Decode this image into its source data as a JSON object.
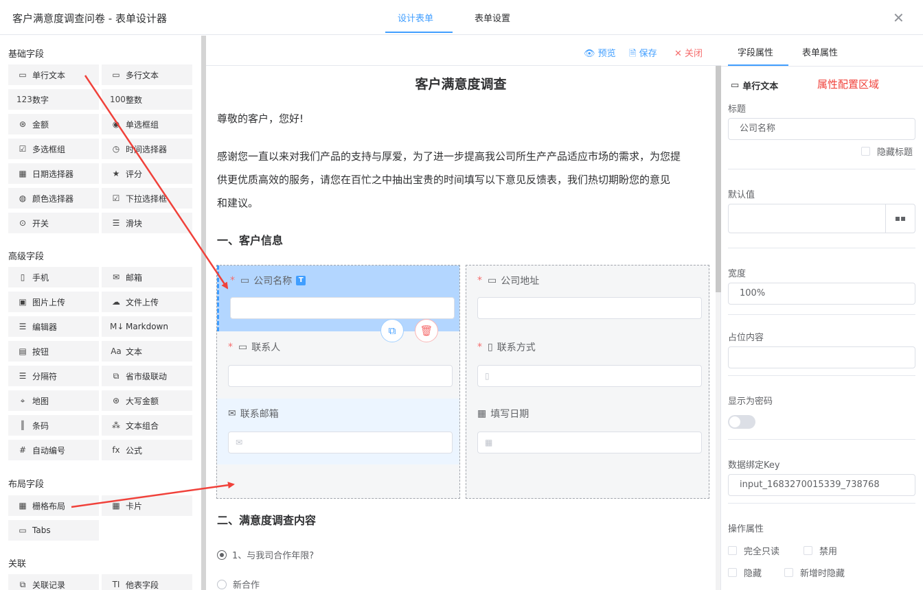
{
  "app_title": "客户满意度调查问卷 - 表单设计器",
  "top_tabs": [
    "设计表单",
    "表单设置"
  ],
  "close_glyph": "✕",
  "left": {
    "groups": [
      {
        "title": "基础字段",
        "items": [
          {
            "label": "单行文本",
            "icon": "▭"
          },
          {
            "label": "多行文本",
            "icon": "▭"
          },
          {
            "label": "数字",
            "icon": "123"
          },
          {
            "label": "整数",
            "icon": "100"
          },
          {
            "label": "金额",
            "icon": "⊛"
          },
          {
            "label": "单选框组",
            "icon": "◉"
          },
          {
            "label": "多选框组",
            "icon": "☑"
          },
          {
            "label": "时间选择器",
            "icon": "◷"
          },
          {
            "label": "日期选择器",
            "icon": "▦"
          },
          {
            "label": "评分",
            "icon": "★"
          },
          {
            "label": "颜色选择器",
            "icon": "◍"
          },
          {
            "label": "下拉选择框",
            "icon": "☑"
          },
          {
            "label": "开关",
            "icon": "⊙"
          },
          {
            "label": "滑块",
            "icon": "☰"
          }
        ]
      },
      {
        "title": "高级字段",
        "items": [
          {
            "label": "手机",
            "icon": "▯"
          },
          {
            "label": "邮箱",
            "icon": "✉"
          },
          {
            "label": "图片上传",
            "icon": "▣"
          },
          {
            "label": "文件上传",
            "icon": "☁"
          },
          {
            "label": "编辑器",
            "icon": "☰"
          },
          {
            "label": "Markdown",
            "icon": "M↓"
          },
          {
            "label": "按钮",
            "icon": "▤"
          },
          {
            "label": "文本",
            "icon": "Aa"
          },
          {
            "label": "分隔符",
            "icon": "☰"
          },
          {
            "label": "省市级联动",
            "icon": "⧉"
          },
          {
            "label": "地图",
            "icon": "⌖"
          },
          {
            "label": "大写金额",
            "icon": "⊛"
          },
          {
            "label": "条码",
            "icon": "║"
          },
          {
            "label": "文本组合",
            "icon": "⁂"
          },
          {
            "label": "自动编号",
            "icon": "#"
          },
          {
            "label": "公式",
            "icon": "fx"
          }
        ]
      },
      {
        "title": "布局字段",
        "items": [
          {
            "label": "栅格布局",
            "icon": "▦"
          },
          {
            "label": "卡片",
            "icon": "▦"
          },
          {
            "label": "Tabs",
            "icon": "▭"
          }
        ]
      },
      {
        "title": "关联",
        "items": [
          {
            "label": "关联记录",
            "icon": "⧉"
          },
          {
            "label": "他表字段",
            "icon": "TI"
          }
        ]
      }
    ]
  },
  "toolbar": {
    "preview": "预览",
    "save": "保存",
    "close": "关闭"
  },
  "form": {
    "title": "客户满意度调查",
    "greeting": "尊敬的客户，您好!",
    "intro_lines": [
      "感谢您一直以来对我们产品的支持与厚爱，为了进一步提高我公司所生产产品适应市场的需求，为您提",
      "供更优质高效的服务，请您在百忙之中抽出宝贵的时间填写以下意见反馈表，我们热切期盼您的意见",
      "和建议。"
    ],
    "section1": "一、客户信息",
    "section2": "二、满意度调查内容",
    "fields": {
      "company_name": "公司名称",
      "company_address": "公司地址",
      "contact": "联系人",
      "contact_method": "联系方式",
      "contact_email": "联系邮箱",
      "fill_date": "填写日期"
    },
    "badge_t": "T",
    "question1": "1、与我司合作年限?",
    "option1": "新合作"
  },
  "right": {
    "tabs": [
      "字段属性",
      "表单属性"
    ],
    "field_type": "单行文本",
    "annotation": "属性配置区域",
    "title_label": "标题",
    "title_value": "公司名称",
    "hide_title": "隐藏标题",
    "default_label": "默认值",
    "width_label": "宽度",
    "width_value": "100%",
    "placeholder_label": "占位内容",
    "password_label": "显示为密码",
    "key_label": "数据绑定Key",
    "key_value": "input_1683270015339_738768",
    "ops_label": "操作属性",
    "ops": [
      "完全只读",
      "禁用",
      "隐藏",
      "新增时隐藏"
    ]
  },
  "colors": {
    "accent": "#409eff",
    "danger": "#f56c6c",
    "arrow": "#f0413a"
  }
}
